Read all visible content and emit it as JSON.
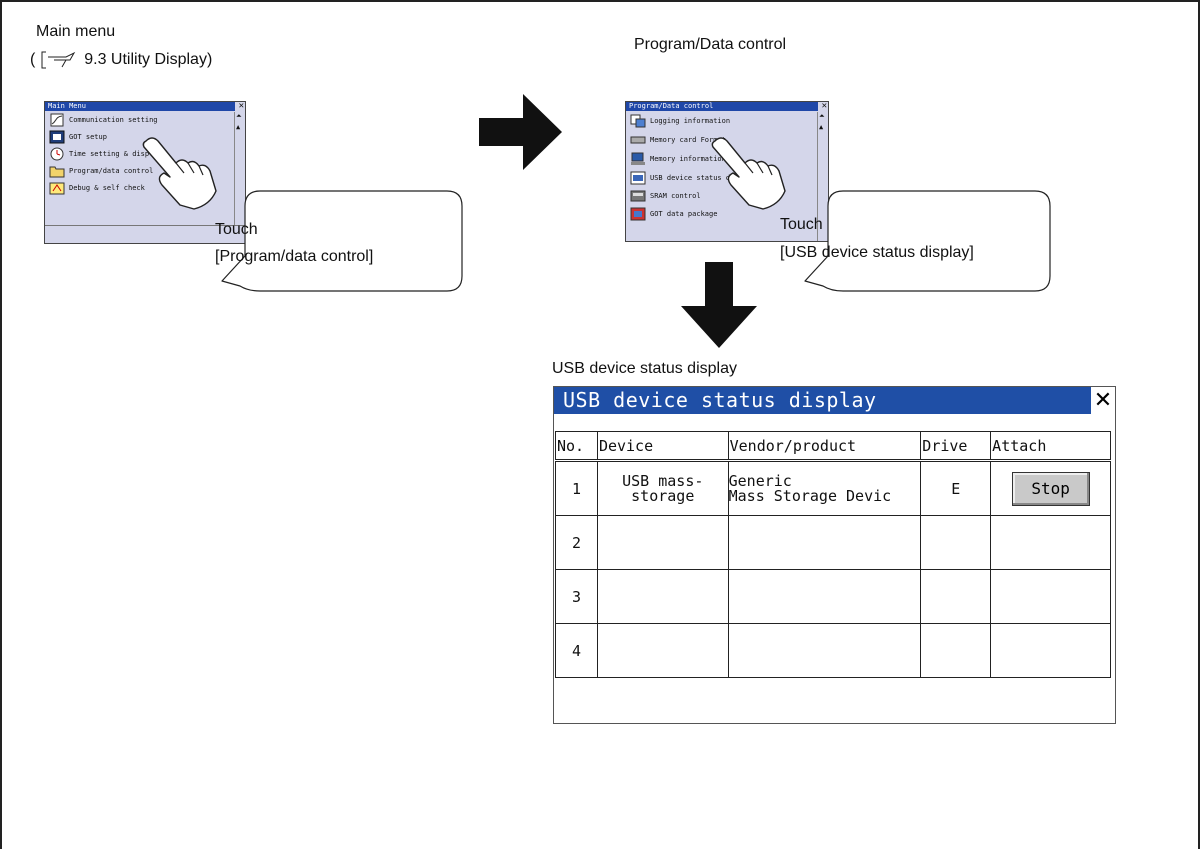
{
  "main_menu_label": "Main menu",
  "reference": {
    "open": "(",
    "text": "9.3 Utility Display)"
  },
  "program_data_label": "Program/Data control",
  "usb_label": "USB device status display",
  "main_menu_screen": {
    "title": "Main Menu",
    "items": [
      {
        "label": "Communication setting",
        "icon": "communication-icon"
      },
      {
        "label": "GOT setup",
        "icon": "got-setup-icon"
      },
      {
        "label": "Time setting & display",
        "icon": "clock-icon"
      },
      {
        "label": "Program/data control",
        "icon": "folder-icon"
      },
      {
        "label": "Debug & self check",
        "icon": "debug-icon"
      }
    ]
  },
  "program_screen": {
    "title": "Program/Data control",
    "items": [
      {
        "label": "Logging information",
        "icon": "logging-icon"
      },
      {
        "label": "Memory card Format",
        "icon": "memory-card-icon"
      },
      {
        "label": "Memory information",
        "icon": "memory-info-icon"
      },
      {
        "label": "USB device status display",
        "icon": "usb-icon"
      },
      {
        "label": "SRAM control",
        "icon": "sram-icon"
      },
      {
        "label": "GOT data package",
        "icon": "got-data-icon"
      }
    ]
  },
  "callout1": {
    "line1": "Touch",
    "line2": "[Program/data control]"
  },
  "callout2": {
    "line1": "Touch",
    "line2": "[USB device status display]"
  },
  "usb_screen": {
    "title": "USB device status display",
    "close": "✕",
    "headers": [
      "No.",
      "Device",
      "Vendor/product",
      "Drive",
      "Attach"
    ],
    "rows": [
      {
        "no": "1",
        "device_line1": "USB mass-",
        "device_line2": "storage",
        "vendor_line1": "Generic",
        "vendor_line2": "Mass Storage Devic",
        "drive": "E",
        "attach": "Stop"
      },
      {
        "no": "2"
      },
      {
        "no": "3"
      },
      {
        "no": "4"
      }
    ]
  }
}
